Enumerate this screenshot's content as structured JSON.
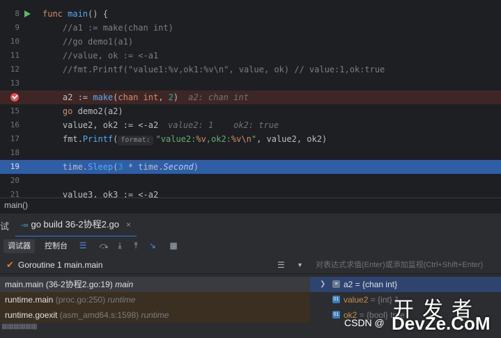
{
  "editor": {
    "lines": [
      {
        "num": "8",
        "tokens": [
          {
            "t": "func ",
            "c": "k"
          },
          {
            "t": "main",
            "c": "f"
          },
          {
            "t": "() {",
            "c": ""
          }
        ]
      },
      {
        "num": "9",
        "tokens": [
          {
            "t": "    //a1 := make(chan int)",
            "c": "c"
          }
        ]
      },
      {
        "num": "10",
        "tokens": [
          {
            "t": "    //go demo1(a1)",
            "c": "c"
          }
        ]
      },
      {
        "num": "11",
        "tokens": [
          {
            "t": "    //value, ok := <-a1",
            "c": "c"
          }
        ]
      },
      {
        "num": "12",
        "tokens": [
          {
            "t": "    //fmt.Printf(\"value1:%v,ok1:%v\\n\", value, ok) // value:1,ok:true",
            "c": "c"
          }
        ]
      },
      {
        "num": "13",
        "tokens": []
      },
      {
        "num": "",
        "tokens": [
          {
            "t": "    a2 := ",
            "c": ""
          },
          {
            "t": "make",
            "c": "fc"
          },
          {
            "t": "(",
            "c": ""
          },
          {
            "t": "chan int",
            "c": "k"
          },
          {
            "t": ", ",
            "c": ""
          },
          {
            "t": "2",
            "c": "n"
          },
          {
            "t": ")",
            "c": ""
          }
        ],
        "hint": "a2: chan int"
      },
      {
        "num": "15",
        "tokens": [
          {
            "t": "    ",
            "c": ""
          },
          {
            "t": "go ",
            "c": "k"
          },
          {
            "t": "demo2(a2)",
            "c": ""
          }
        ]
      },
      {
        "num": "16",
        "tokens": [
          {
            "t": "    value2, ok2 := <-a2",
            "c": ""
          }
        ],
        "hint": "value2: 1    ok2: true"
      },
      {
        "num": "17",
        "tokens": [
          {
            "t": "    fmt.",
            "c": ""
          },
          {
            "t": "Printf",
            "c": "fc"
          },
          {
            "t": "(",
            "c": ""
          }
        ],
        "param_hint": "format:",
        "tail": [
          {
            "t": "\"value2:",
            "c": "s"
          },
          {
            "t": "%v",
            "c": "k"
          },
          {
            "t": ",ok2:",
            "c": "s"
          },
          {
            "t": "%v\\n",
            "c": "k"
          },
          {
            "t": "\"",
            "c": "s"
          },
          {
            "t": ", value2, ok2)",
            "c": ""
          }
        ]
      },
      {
        "num": "18",
        "tokens": []
      },
      {
        "num": "19",
        "tokens": [
          {
            "t": "    time.",
            "c": ""
          },
          {
            "t": "Sleep",
            "c": "fc"
          },
          {
            "t": "(",
            "c": ""
          },
          {
            "t": "3",
            "c": "n"
          },
          {
            "t": " * time.",
            "c": ""
          },
          {
            "t": "Second",
            "c": "it2"
          },
          {
            "t": ")",
            "c": ""
          }
        ]
      },
      {
        "num": "20",
        "tokens": []
      },
      {
        "num": "21",
        "tokens": [
          {
            "t": "    value3, ok3 := <-a2",
            "c": ""
          }
        ]
      }
    ]
  },
  "breadcrumb": "main()",
  "run_tab": {
    "label": "go build 36-2协程2.go",
    "close": "×"
  },
  "tab_edge_label": "试",
  "toolbar": {
    "debugger_label": "调试器",
    "console_label": "控制台"
  },
  "threads": {
    "goroutine_label": "Goroutine 1 main.main",
    "frames": [
      {
        "func": "main.main",
        "loc": "(36-2协程2.go:19)",
        "pkg": "main"
      },
      {
        "func": "runtime.main",
        "loc": "(proc.go:250)",
        "pkg": "runtime"
      },
      {
        "func": "runtime.goexit",
        "loc": "(asm_amd64.s:1598)",
        "pkg": "runtime"
      }
    ],
    "more": "▦▦▦▦▦▦"
  },
  "variables": {
    "eval_placeholder": "对表达式求值(Enter)或添加监视(Ctrl+Shift+Enter)",
    "items": [
      {
        "name": "a2",
        "value": "= {chan int}",
        "icon": "list"
      },
      {
        "name": "value2",
        "value": "= {int} 1",
        "icon": "prim"
      },
      {
        "name": "ok2",
        "value": "= {bool} true",
        "icon": "prim"
      }
    ]
  },
  "watermark": {
    "cn": "开发者",
    "csdn": "CSDN @",
    "brand": "DevZe.CoM"
  },
  "colors": {
    "accent": "#3574f0",
    "selected_line": "#2e5ea6",
    "breakpoint_line": "#3f2626",
    "breakpoint": "#e55353"
  }
}
